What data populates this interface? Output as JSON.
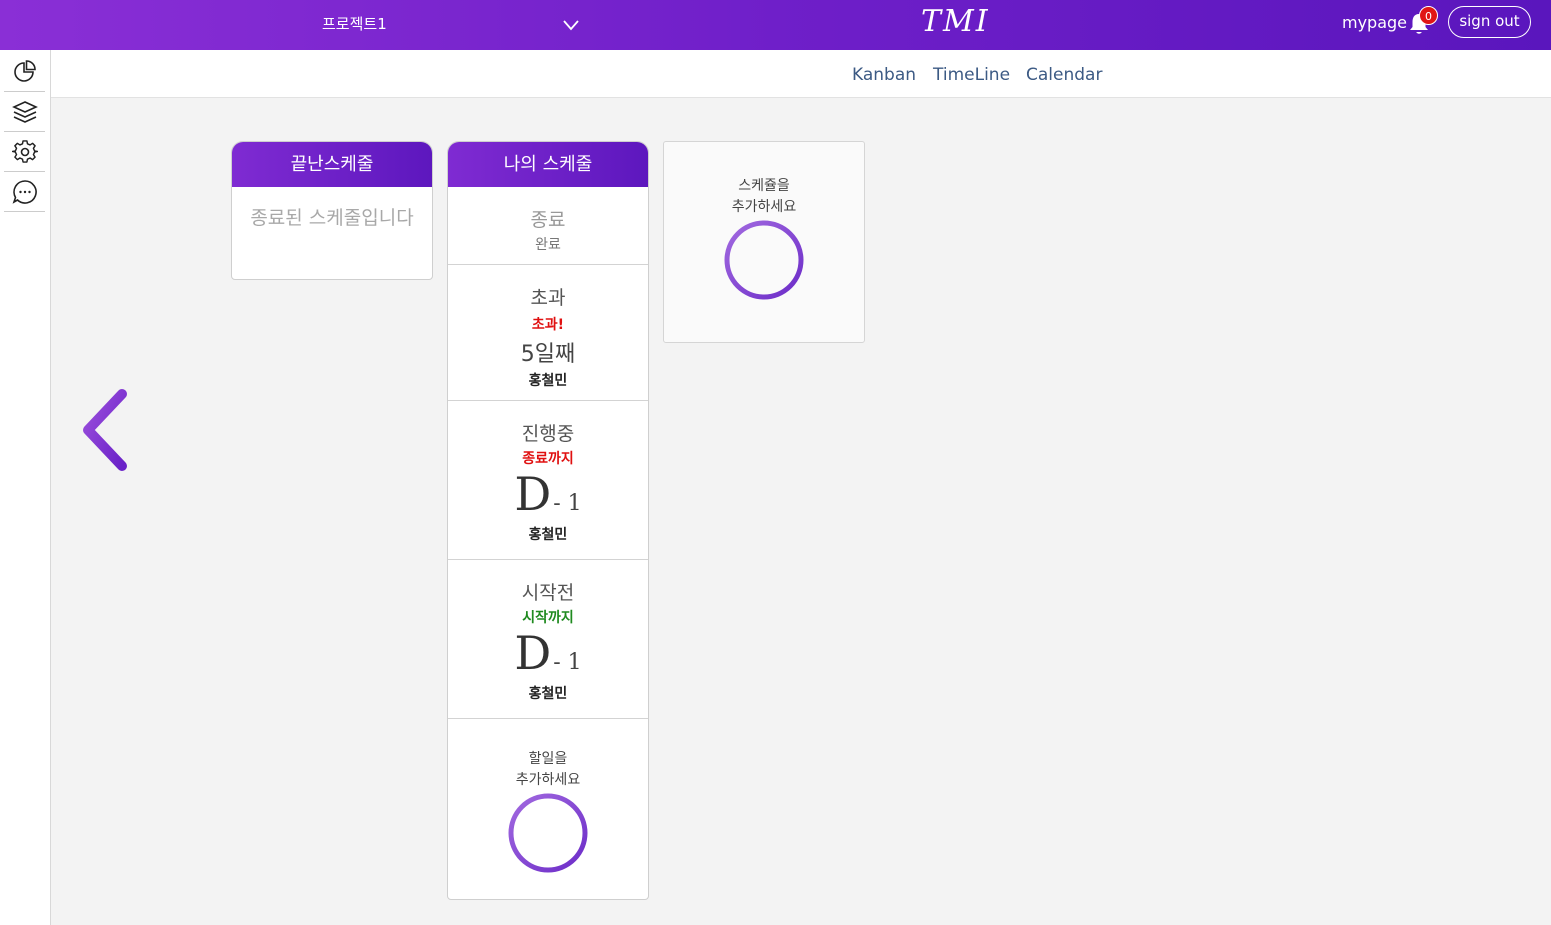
{
  "header": {
    "project": "프로젝트1",
    "logo": "TMI",
    "mypage": "mypage",
    "notification_count": "0",
    "signout": "sign out"
  },
  "sidebar": {
    "icons": [
      "chart-pie-icon",
      "layers-icon",
      "gear-icon",
      "chat-icon"
    ]
  },
  "subnav": {
    "kanban": "Kanban",
    "timeline": "TimeLine",
    "calendar": "Calendar"
  },
  "columns": {
    "done": {
      "title": "끝난스케줄",
      "empty": "종료된 스케줄입니다"
    },
    "mine": {
      "title": "나의 스케줄",
      "card_done": {
        "title": "종료",
        "sub": "완료"
      },
      "card_over": {
        "title": "초과",
        "alert": "초과!",
        "days": "5일째",
        "owner": "홍철민"
      },
      "card_progress": {
        "title": "진행중",
        "label": "종료까지",
        "d": "D",
        "num": "- 1",
        "owner": "홍철민"
      },
      "card_before": {
        "title": "시작전",
        "label": "시작까지",
        "d": "D",
        "num": "- 1",
        "owner": "홍철민"
      },
      "add_task_line1": "할일을",
      "add_task_line2": "추가하세요"
    }
  },
  "add_schedule": {
    "line1": "스케쥴을",
    "line2": "추가하세요"
  },
  "colors": {
    "accent": "#7324cf",
    "danger": "#e01010",
    "success": "#1f8a1f",
    "link": "#3c5a84"
  }
}
